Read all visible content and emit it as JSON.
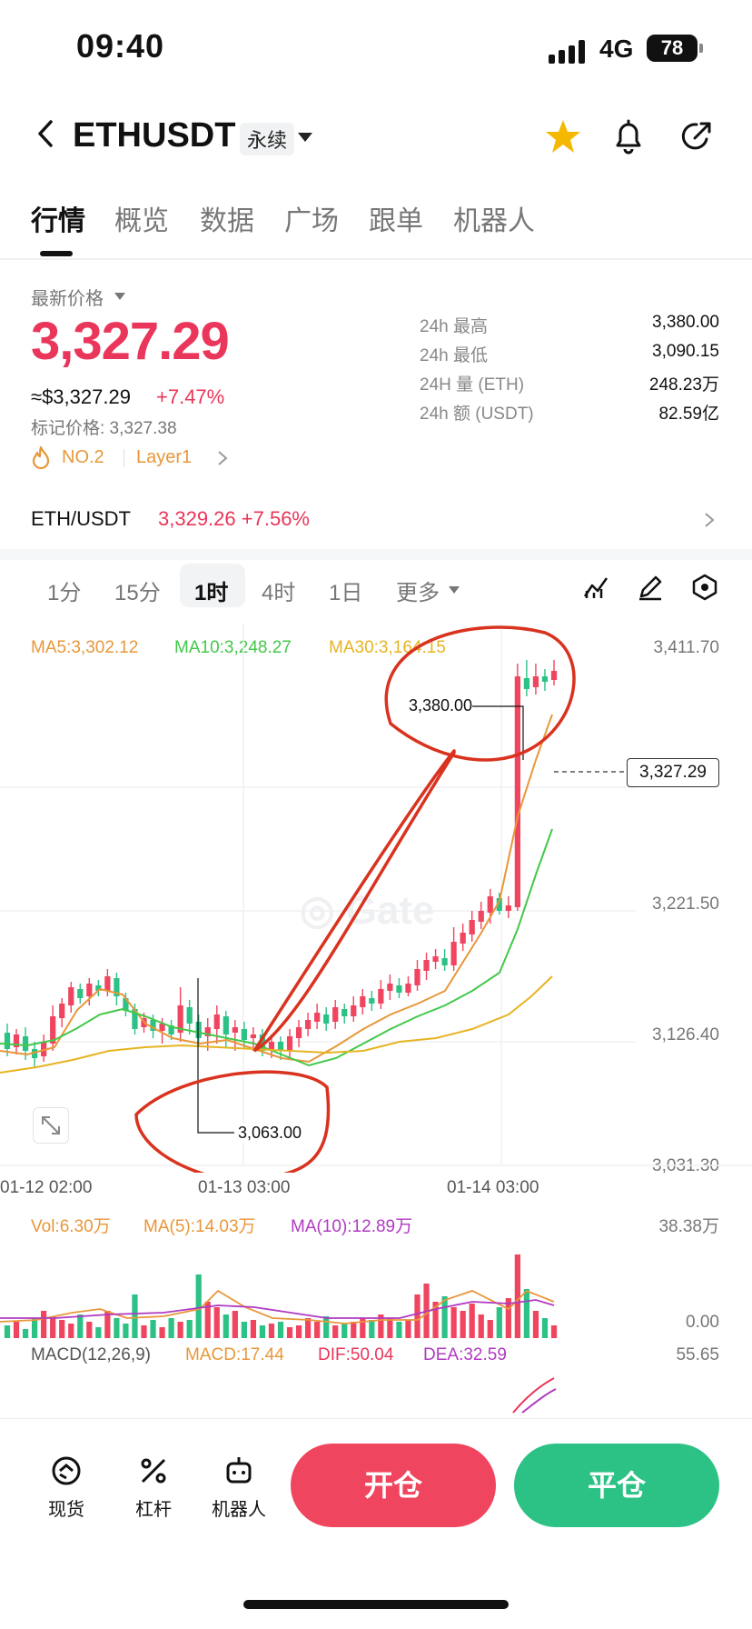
{
  "status_bar": {
    "time": "09:40",
    "network": "4G",
    "battery": "78"
  },
  "header": {
    "symbol": "ETHUSDT",
    "contract_type": "永续",
    "icons": [
      "back-icon",
      "star-icon",
      "bell-icon",
      "share-icon"
    ]
  },
  "tabs": [
    "行情",
    "概览",
    "数据",
    "广场",
    "跟单",
    "机器人"
  ],
  "price": {
    "latest_label": "最新价格",
    "last": "3,327.29",
    "usd": "≈$3,327.29",
    "change": "+7.47%",
    "mark_price": "标记价格: 3,327.38",
    "rank": "NO.2",
    "sector": "Layer1"
  },
  "stats": [
    {
      "label": "24h  最高",
      "value": "3,380.00"
    },
    {
      "label": "24h  最低",
      "value": "3,090.15"
    },
    {
      "label": "24H  量 (ETH)",
      "value": "248.23万"
    },
    {
      "label": "24h  额 (USDT)",
      "value": "82.59亿"
    }
  ],
  "spot_pair": {
    "name": "ETH/USDT",
    "price": "3,329.26",
    "change": "+7.56%"
  },
  "intervals": {
    "items": [
      "1分",
      "15分",
      "1时",
      "4时",
      "1日",
      "更多"
    ],
    "active": "1时"
  },
  "chart": {
    "ma_legend": {
      "ma5": "MA5:3,302.12",
      "ma10": "MA10:3,248.27",
      "ma30": "MA30:3,164.15"
    },
    "y_ticks": [
      "3,411.70",
      "3,221.50",
      "3,126.40",
      "3,031.30"
    ],
    "x_ticks": [
      "01-12 02:00",
      "01-13 03:00",
      "01-14 03:00"
    ],
    "last_price_tag": "3,327.29",
    "high_callout": "3,380.00",
    "low_callout": "3,063.00",
    "watermark": "Gate"
  },
  "volume": {
    "vol": "Vol:6.30万",
    "ma5": "MA(5):14.03万",
    "ma10": "MA(10):12.89万",
    "top": "38.38万",
    "bottom": "0.00"
  },
  "macd": {
    "label": "MACD(12,26,9)",
    "macd": "MACD:17.44",
    "dif": "DIF:50.04",
    "dea": "DEA:32.59",
    "top": "55.65"
  },
  "bottom_bar": {
    "spot": "现货",
    "leverage": "杠杆",
    "bot": "机器人",
    "open": "开仓",
    "close": "平仓"
  },
  "colors": {
    "up": "#f0455f",
    "down": "#2cc185",
    "ma5": "#e8973a",
    "ma10": "#43c84a",
    "ma30": "#e6b422",
    "annotation": "#d9331f"
  }
}
